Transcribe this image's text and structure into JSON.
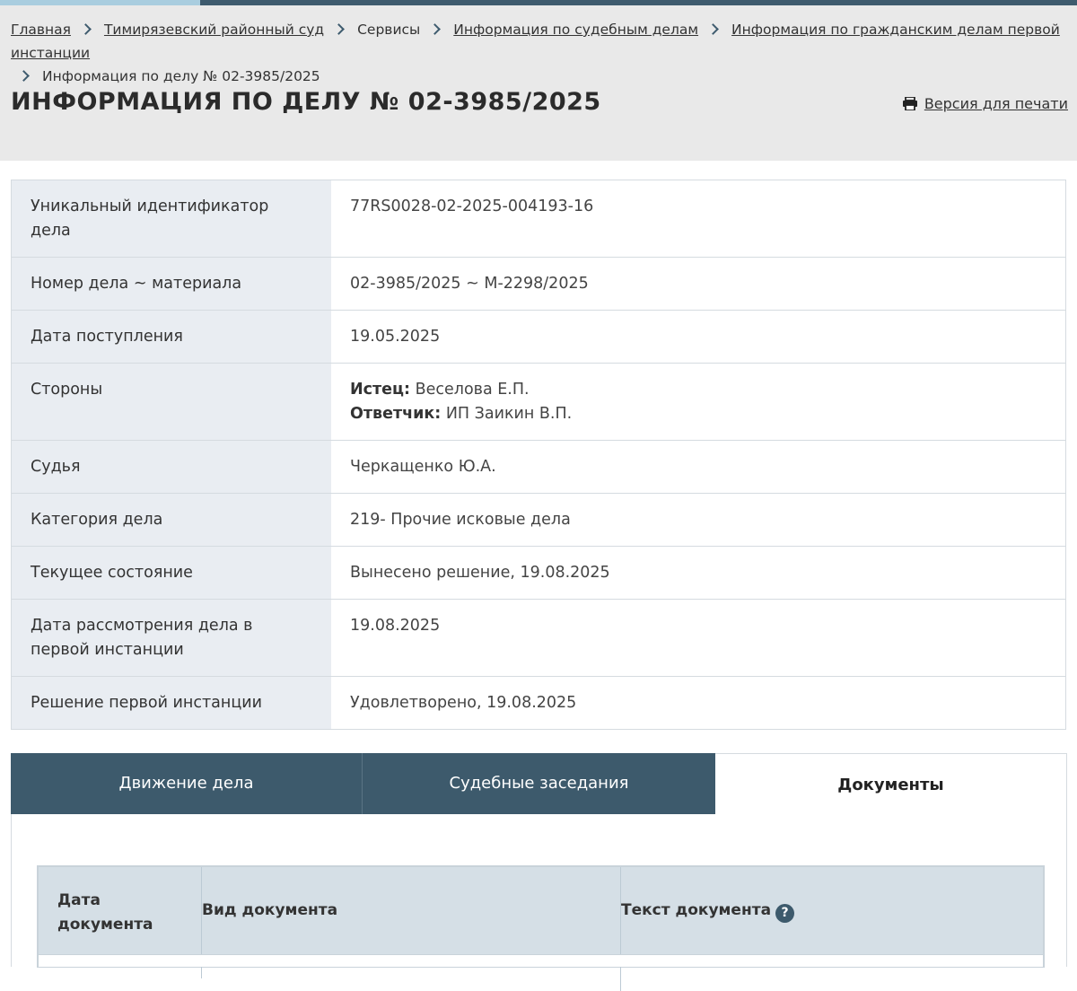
{
  "breadcrumbs": [
    {
      "label": "Главная",
      "link": true
    },
    {
      "label": "Тимирязевский районный суд",
      "link": true
    },
    {
      "label": "Сервисы",
      "link": false
    },
    {
      "label": "Информация по судебным делам",
      "link": true
    },
    {
      "label": "Информация по гражданским делам первой инстанции",
      "link": true
    },
    {
      "label": "Информация по делу № 02-3985/2025",
      "link": false
    }
  ],
  "page_title": "Информация по делу № 02-3985/2025",
  "print_link": {
    "label": "Версия для печати",
    "icon": "printer-icon"
  },
  "case_info": [
    {
      "key": "Уникальный идентификатор дела",
      "value": "77RS0028-02-2025-004193-16"
    },
    {
      "key": "Номер дела ~ материала",
      "value": "02-3985/2025 ~ М-2298/2025"
    },
    {
      "key": "Дата поступления",
      "value": "19.05.2025"
    },
    {
      "key": "Стороны",
      "parties": [
        {
          "role": "Истец:",
          "name": "Веселова Е.П."
        },
        {
          "role": "Ответчик:",
          "name": "ИП Заикин В.П."
        }
      ]
    },
    {
      "key": "Судья",
      "value": "Черкащенко Ю.А."
    },
    {
      "key": "Категория дела",
      "value": "219- Прочие исковые дела"
    },
    {
      "key": "Текущее состояние",
      "value": "Вынесено решение, 19.08.2025"
    },
    {
      "key": "Дата рассмотрения дела в первой инстанции",
      "value": "19.08.2025"
    },
    {
      "key": "Решение первой инстанции",
      "value": "Удовлетворено, 19.08.2025"
    }
  ],
  "tabs": [
    {
      "label": "Движение дела",
      "active": false
    },
    {
      "label": "Судебные заседания",
      "active": false
    },
    {
      "label": "Документы",
      "active": true
    }
  ],
  "documents_table": {
    "headers": [
      "Дата документа",
      "Вид документа",
      "Текст документа"
    ],
    "help_icon": "?"
  },
  "colors": {
    "accent": "#3d5a6c",
    "header_bg": "#e9e9e9",
    "key_bg": "#e9edf2"
  }
}
